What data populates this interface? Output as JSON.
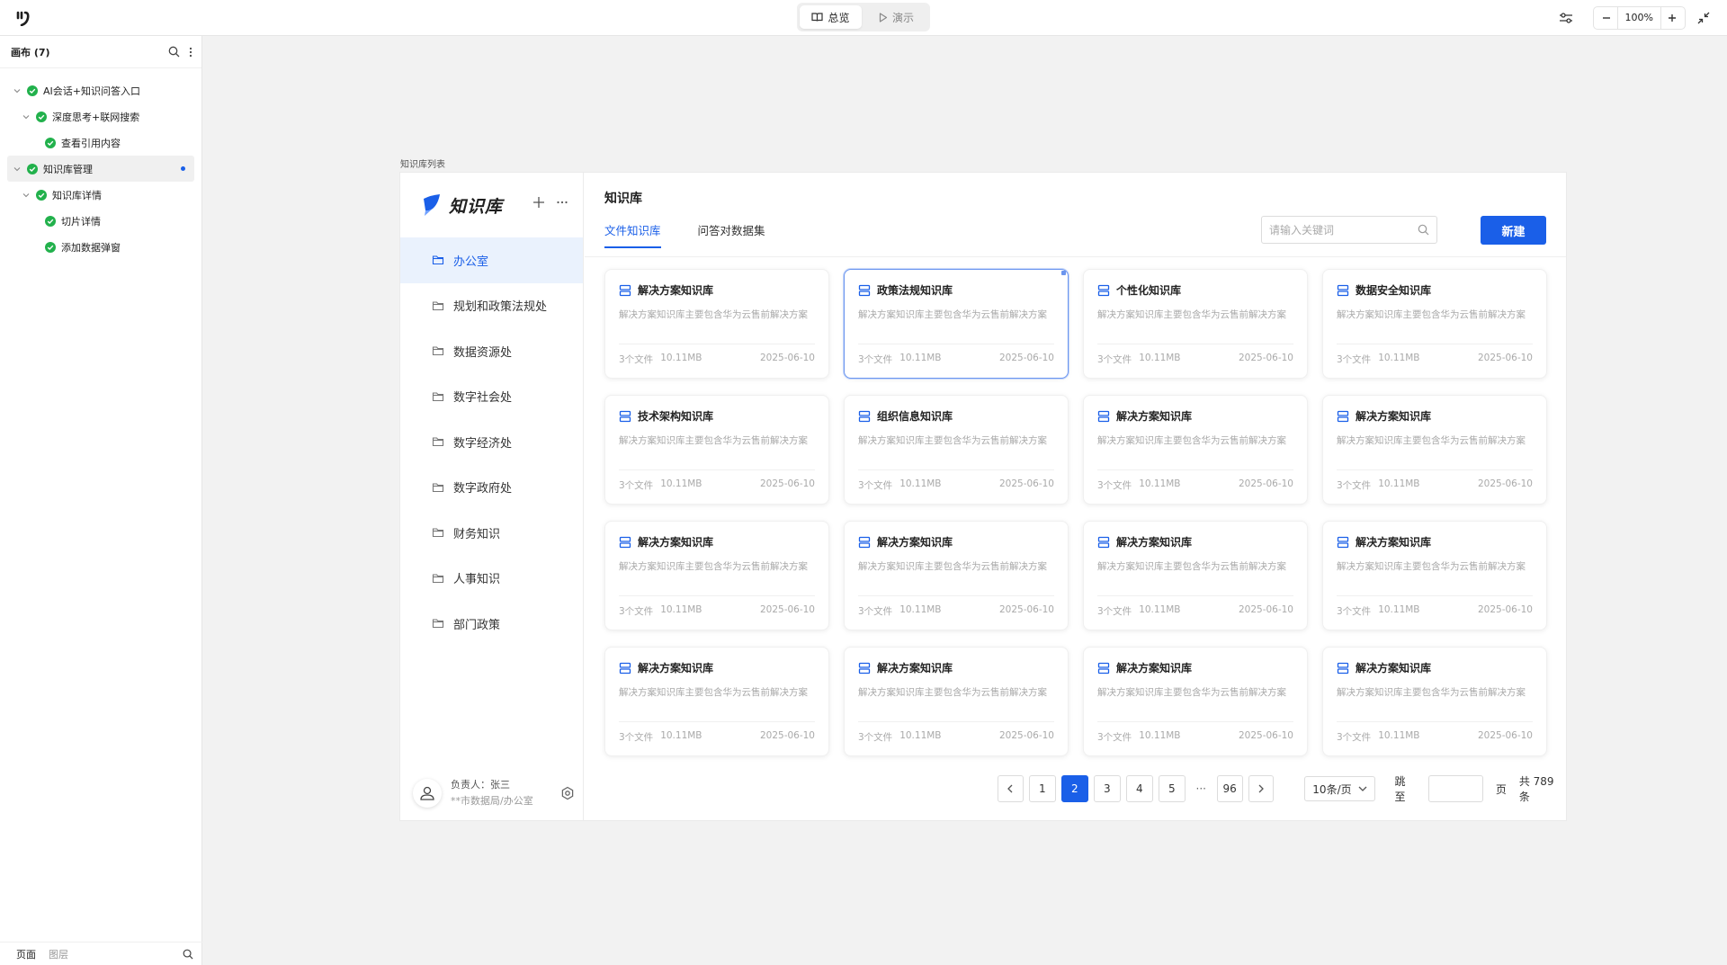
{
  "topbar": {
    "modes": [
      {
        "label": "总览",
        "icon": "book-icon",
        "active": true
      },
      {
        "label": "演示",
        "icon": "play-icon",
        "active": false
      }
    ],
    "zoom": "100%"
  },
  "left_panel": {
    "title": "画布 (7)",
    "tree": [
      {
        "label": "AI会话+知识问答入口",
        "level": 0,
        "collapsible": true
      },
      {
        "label": "深度思考+联网搜索",
        "level": 1,
        "collapsible": true
      },
      {
        "label": "查看引用内容",
        "level": 2,
        "collapsible": false
      },
      {
        "label": "知识库管理",
        "level": 0,
        "collapsible": true,
        "selected": true
      },
      {
        "label": "知识库详情",
        "level": 1,
        "collapsible": true
      },
      {
        "label": "切片详情",
        "level": 2,
        "collapsible": false
      },
      {
        "label": "添加数据弹窗",
        "level": 2,
        "collapsible": false
      }
    ],
    "footer": {
      "pages": "页面",
      "layers": "图层"
    }
  },
  "frame": {
    "label": "知识库列表",
    "brand": "知识库",
    "menu": [
      "办公室",
      "规划和政策法规处",
      "数据资源处",
      "数字社会处",
      "数字经济处",
      "数字政府处",
      "财务知识",
      "人事知识",
      "部门政策"
    ],
    "owner": {
      "name": "负责人：张三",
      "dept": "**市数据局/办公室"
    },
    "main": {
      "title": "知识库",
      "tabs": [
        "文件知识库",
        "问答对数据集"
      ],
      "search_placeholder": "请输入关键词",
      "new_button": "新建",
      "cards": [
        {
          "title": "解决方案知识库",
          "desc": "解决方案知识库主要包含华为云售前解决方案",
          "files": "3个文件",
          "size": "10.11MB",
          "date": "2025-06-10"
        },
        {
          "title": "政策法规知识库",
          "desc": "解决方案知识库主要包含华为云售前解决方案",
          "files": "3个文件",
          "size": "10.11MB",
          "date": "2025-06-10",
          "selected": true
        },
        {
          "title": "个性化知识库",
          "desc": "解决方案知识库主要包含华为云售前解决方案",
          "files": "3个文件",
          "size": "10.11MB",
          "date": "2025-06-10"
        },
        {
          "title": "数据安全知识库",
          "desc": "解决方案知识库主要包含华为云售前解决方案",
          "files": "3个文件",
          "size": "10.11MB",
          "date": "2025-06-10"
        },
        {
          "title": "技术架构知识库",
          "desc": "解决方案知识库主要包含华为云售前解决方案",
          "files": "3个文件",
          "size": "10.11MB",
          "date": "2025-06-10"
        },
        {
          "title": "组织信息知识库",
          "desc": "解决方案知识库主要包含华为云售前解决方案",
          "files": "3个文件",
          "size": "10.11MB",
          "date": "2025-06-10"
        },
        {
          "title": "解决方案知识库",
          "desc": "解决方案知识库主要包含华为云售前解决方案",
          "files": "3个文件",
          "size": "10.11MB",
          "date": "2025-06-10"
        },
        {
          "title": "解决方案知识库",
          "desc": "解决方案知识库主要包含华为云售前解决方案",
          "files": "3个文件",
          "size": "10.11MB",
          "date": "2025-06-10"
        },
        {
          "title": "解决方案知识库",
          "desc": "解决方案知识库主要包含华为云售前解决方案",
          "files": "3个文件",
          "size": "10.11MB",
          "date": "2025-06-10"
        },
        {
          "title": "解决方案知识库",
          "desc": "解决方案知识库主要包含华为云售前解决方案",
          "files": "3个文件",
          "size": "10.11MB",
          "date": "2025-06-10"
        },
        {
          "title": "解决方案知识库",
          "desc": "解决方案知识库主要包含华为云售前解决方案",
          "files": "3个文件",
          "size": "10.11MB",
          "date": "2025-06-10"
        },
        {
          "title": "解决方案知识库",
          "desc": "解决方案知识库主要包含华为云售前解决方案",
          "files": "3个文件",
          "size": "10.11MB",
          "date": "2025-06-10"
        },
        {
          "title": "解决方案知识库",
          "desc": "解决方案知识库主要包含华为云售前解决方案",
          "files": "3个文件",
          "size": "10.11MB",
          "date": "2025-06-10"
        },
        {
          "title": "解决方案知识库",
          "desc": "解决方案知识库主要包含华为云售前解决方案",
          "files": "3个文件",
          "size": "10.11MB",
          "date": "2025-06-10"
        },
        {
          "title": "解决方案知识库",
          "desc": "解决方案知识库主要包含华为云售前解决方案",
          "files": "3个文件",
          "size": "10.11MB",
          "date": "2025-06-10"
        },
        {
          "title": "解决方案知识库",
          "desc": "解决方案知识库主要包含华为云售前解决方案",
          "files": "3个文件",
          "size": "10.11MB",
          "date": "2025-06-10"
        }
      ],
      "pagination": {
        "pages": [
          "1",
          "2",
          "3",
          "4",
          "5"
        ],
        "current": "2",
        "ellipsis": "···",
        "last": "96",
        "page_size": "10条/页",
        "jump_label": "跳至",
        "page_unit": "页",
        "total": "共 789 条"
      }
    }
  },
  "colors": {
    "accent": "#1a5fe8",
    "check": "#22b14c",
    "active_bg": "#eaf2fd"
  }
}
